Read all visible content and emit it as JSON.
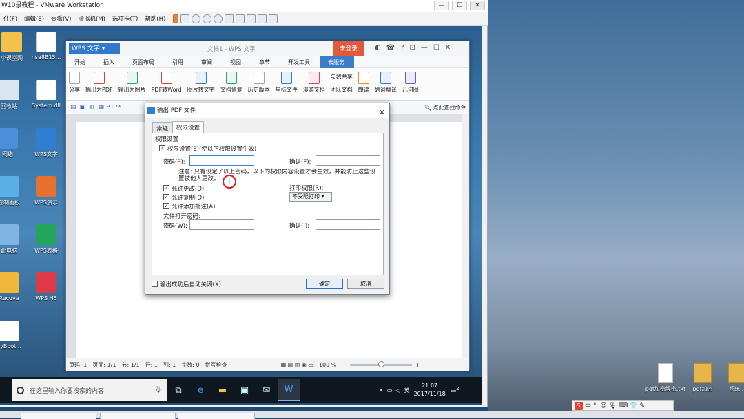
{
  "vmware": {
    "title": "W10录教程 - VMware Workstation",
    "menu": [
      "件(F)",
      "编辑(E)",
      "查看(V)",
      "虚拟机(M)",
      "选项卡(T)",
      "帮助(H)"
    ],
    "controls": {
      "minimize": "—",
      "maximize": "☐",
      "close": "✕"
    }
  },
  "desktop_icons": [
    {
      "label": "小课堂网"
    },
    {
      "label": "nsa8B15..."
    },
    {
      "label": "回收站"
    },
    {
      "label": "System.dll"
    },
    {
      "label": "网络"
    },
    {
      "label": "WPS文字"
    },
    {
      "label": "控制面板"
    },
    {
      "label": "WPS演示"
    },
    {
      "label": "此电脑"
    },
    {
      "label": "WPS表格"
    },
    {
      "label": "Recuva"
    },
    {
      "label": "WPS H5"
    },
    {
      "label": "dyBoot..."
    }
  ],
  "wps": {
    "app_label": "WPS 文字",
    "doc_title": "文档1 - WPS 文字",
    "login_label": "未登录",
    "tabs": [
      "开始",
      "插入",
      "页面布局",
      "引用",
      "审阅",
      "视图",
      "章节",
      "开发工具",
      "云服务"
    ],
    "active_tab": "云服务",
    "ribbon": {
      "share": "分享",
      "export_pdf": "输出为PDF",
      "export_image": "输出为图片",
      "pdf_to_word": "PDF转Word",
      "image_to_text": "图片转文字",
      "doc_repair": "文档修复",
      "history": "历史版本",
      "star_doc": "星标文件",
      "roam_doc": "漫游文档",
      "shared_with_me": "与我共享",
      "team_doc": "团队文档",
      "read_aloud": "朗读",
      "translate": "划词翻译",
      "geometry": "几何图"
    },
    "find_label": "点此查找命令",
    "status": {
      "page": "页码: 1",
      "pages": "页面: 1/1",
      "section": "节: 1/1",
      "row": "行: 1",
      "col": "列: 1",
      "words": "字数: 0",
      "spell": "拼写检查",
      "zoom": "100 %",
      "zoom_level": 0.5
    }
  },
  "dialog": {
    "title": "输出 PDF 文件",
    "tabs": [
      "常规",
      "权限设置"
    ],
    "active_tab": "权限设置",
    "group_title": "权限设置",
    "enable_permission": "权限设置(E)(使以下权限设置生效)",
    "password_label": "密码(P):",
    "confirm_label": "确认(F):",
    "note": "注意: 只有设定了以上密码，以下的权限内容设置才会生效，并能防止这些设置被他人更改。",
    "allow_change": "允许更改(D)",
    "allow_copy": "允许复制(O)",
    "allow_annot": "允许添加批注(A)",
    "print_perm_label": "打印权限(R):",
    "print_perm_value": "不受限打印",
    "open_pwd_title": "文件打开密码:",
    "open_pwd_label": "密码(W):",
    "open_confirm_label": "确认(I):",
    "auto_close": "输出成功后自动关闭(X)",
    "ok": "确定",
    "cancel": "取消",
    "checked": "✓"
  },
  "taskbar": {
    "search_placeholder": "在这里输入你要搜索的内容",
    "input_lang": "英",
    "time": "21:07",
    "date": "2017/11/18",
    "notif_count": "2"
  },
  "host_desktop": [
    {
      "label": "pdf加密解密.txt"
    },
    {
      "label": "pdf加密"
    },
    {
      "label": "系统..."
    }
  ],
  "ime": {
    "brand": "S",
    "mode": "中"
  }
}
